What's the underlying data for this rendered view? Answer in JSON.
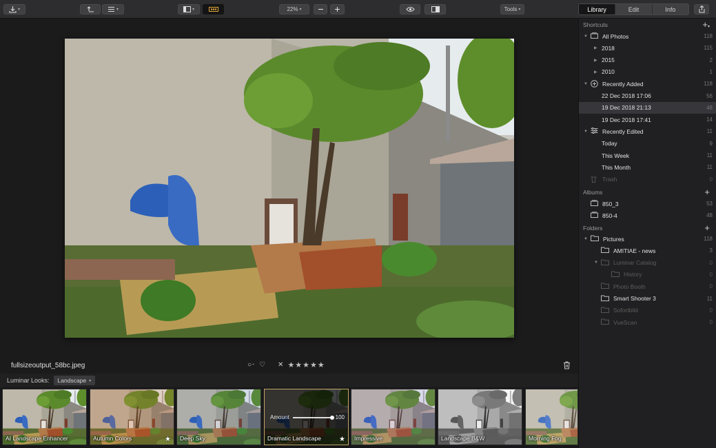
{
  "toolbar": {
    "zoom_label": "22%",
    "tools_label": "Tools",
    "tabs": [
      {
        "label": "Library",
        "selected": true
      },
      {
        "label": "Edit",
        "selected": false
      },
      {
        "label": "Info",
        "selected": false
      }
    ]
  },
  "viewer": {
    "filename": "fullsizeoutput_58bc.jpeg"
  },
  "looks": {
    "label": "Luminar Looks:",
    "selected_category": "Landscape",
    "thumbnails": [
      {
        "label": "AI Landscape Enhancer",
        "starred": false,
        "tint": "none"
      },
      {
        "label": "Autumn Colors",
        "starred": true,
        "tint": "warm"
      },
      {
        "label": "Deep Sky",
        "starred": false,
        "tint": "cool"
      },
      {
        "label": "Dramatic Landscape",
        "starred": true,
        "tint": "dark",
        "selected": true,
        "amount_label": "Amount",
        "amount_value": "100"
      },
      {
        "label": "Impressive",
        "starred": false,
        "tint": "violet"
      },
      {
        "label": "Landscape B&W",
        "starred": false,
        "tint": "bw"
      },
      {
        "label": "Morning Fog",
        "starred": false,
        "tint": "fog"
      }
    ]
  },
  "sidebar": {
    "shortcuts_title": "Shortcuts",
    "albums_title": "Albums",
    "folders_title": "Folders",
    "shortcuts": [
      {
        "label": "All Photos",
        "count": "118",
        "level": 0,
        "icon": "photos-icon",
        "tri": "down"
      },
      {
        "label": "2018",
        "count": "115",
        "level": 1,
        "tri": "right"
      },
      {
        "label": "2015",
        "count": "2",
        "level": 1,
        "tri": "right"
      },
      {
        "label": "2010",
        "count": "1",
        "level": 1,
        "tri": "right"
      },
      {
        "label": "Recently Added",
        "count": "118",
        "level": 0,
        "icon": "plus-circle-icon",
        "tri": "down"
      },
      {
        "label": "22 Dec 2018 17:06",
        "count": "56",
        "level": 1
      },
      {
        "label": "19 Dec 2018 21:13",
        "count": "48",
        "level": 1,
        "selected": true
      },
      {
        "label": "19 Dec 2018 17:41",
        "count": "14",
        "level": 1
      },
      {
        "label": "Recently Edited",
        "count": "11",
        "level": 0,
        "icon": "sliders-icon",
        "tri": "down"
      },
      {
        "label": "Today",
        "count": "9",
        "level": 1
      },
      {
        "label": "This Week",
        "count": "11",
        "level": 1
      },
      {
        "label": "This Month",
        "count": "11",
        "level": 1
      },
      {
        "label": "Trash",
        "count": "0",
        "level": 0,
        "icon": "trash-icon",
        "dim": true
      }
    ],
    "albums": [
      {
        "label": "850_3",
        "count": "53"
      },
      {
        "label": "850-4",
        "count": "48"
      }
    ],
    "folders": [
      {
        "label": "Pictures",
        "count": "118",
        "level": 0,
        "tri": "down"
      },
      {
        "label": "AMITIAE - news",
        "count": "3",
        "level": 1
      },
      {
        "label": "Luminar Catalog",
        "count": "0",
        "level": 1,
        "tri": "down",
        "dim": true
      },
      {
        "label": "History",
        "count": "0",
        "level": 2,
        "dim": true
      },
      {
        "label": "Photo Booth",
        "count": "0",
        "level": 1,
        "dim": true
      },
      {
        "label": "Smart Shooter 3",
        "count": "11",
        "level": 1
      },
      {
        "label": "Sofortbild",
        "count": "0",
        "level": 1,
        "dim": true
      },
      {
        "label": "VueScan",
        "count": "0",
        "level": 1,
        "dim": true
      }
    ]
  }
}
